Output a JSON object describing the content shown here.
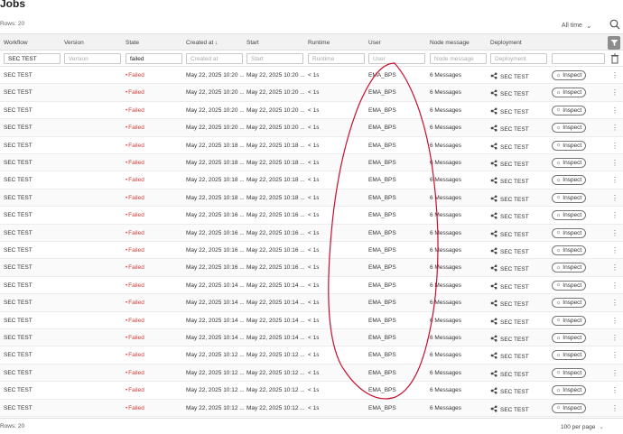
{
  "header": {
    "title": "Jobs",
    "rows_label": "Rows: 20",
    "time_filter": "All time"
  },
  "columns": [
    "Workflow",
    "Version",
    "State",
    "Created at",
    "Start",
    "Runtime",
    "User",
    "Node message",
    "Deployment"
  ],
  "filters": {
    "workflow": {
      "value": "SEC TEST",
      "placeholder": ""
    },
    "version": {
      "value": "",
      "placeholder": "Version"
    },
    "state": {
      "value": "failed",
      "placeholder": ""
    },
    "created": {
      "value": "",
      "placeholder": "Created at"
    },
    "start": {
      "value": "",
      "placeholder": "Start"
    },
    "runtime": {
      "value": "",
      "placeholder": "Runtime"
    },
    "user": {
      "value": "",
      "placeholder": "User"
    },
    "node": {
      "value": "",
      "placeholder": "Node message"
    },
    "deployment": {
      "value": "",
      "placeholder": "Deployment"
    },
    "extra": {
      "value": "",
      "placeholder": ""
    }
  },
  "rows": [
    {
      "workflow": "SEC TEST",
      "state": "Failed",
      "created": "May 22, 2025 10:20 ...",
      "start": "May 22, 2025 10:20 ...",
      "runtime": "< 1s",
      "user": "EMA_BPS",
      "node": "6 Messages",
      "deployment": "SEC TEST"
    },
    {
      "workflow": "SEC TEST",
      "state": "Failed",
      "created": "May 22, 2025 10:20 ...",
      "start": "May 22, 2025 10:20 ...",
      "runtime": "< 1s",
      "user": "EMA_BPS",
      "node": "6 Messages",
      "deployment": "SEC TEST"
    },
    {
      "workflow": "SEC TEST",
      "state": "Failed",
      "created": "May 22, 2025 10:20 ...",
      "start": "May 22, 2025 10:20 ...",
      "runtime": "< 1s",
      "user": "EMA_BPS",
      "node": "6 Messages",
      "deployment": "SEC TEST"
    },
    {
      "workflow": "SEC TEST",
      "state": "Failed",
      "created": "May 22, 2025 10:20 ...",
      "start": "May 22, 2025 10:20 ...",
      "runtime": "< 1s",
      "user": "EMA_BPS",
      "node": "6 Messages",
      "deployment": "SEC TEST"
    },
    {
      "workflow": "SEC TEST",
      "state": "Failed",
      "created": "May 22, 2025 10:18 ...",
      "start": "May 22, 2025 10:18 ...",
      "runtime": "< 1s",
      "user": "EMA_BPS",
      "node": "6 Messages",
      "deployment": "SEC TEST"
    },
    {
      "workflow": "SEC TEST",
      "state": "Failed",
      "created": "May 22, 2025 10:18 ...",
      "start": "May 22, 2025 10:18 ...",
      "runtime": "< 1s",
      "user": "EMA_BPS",
      "node": "6 Messages",
      "deployment": "SEC TEST"
    },
    {
      "workflow": "SEC TEST",
      "state": "Failed",
      "created": "May 22, 2025 10:18 ...",
      "start": "May 22, 2025 10:18 ...",
      "runtime": "< 1s",
      "user": "EMA_BPS",
      "node": "6 Messages",
      "deployment": "SEC TEST"
    },
    {
      "workflow": "SEC TEST",
      "state": "Failed",
      "created": "May 22, 2025 10:18 ...",
      "start": "May 22, 2025 10:18 ...",
      "runtime": "< 1s",
      "user": "EMA_BPS",
      "node": "6 Messages",
      "deployment": "SEC TEST"
    },
    {
      "workflow": "SEC TEST",
      "state": "Failed",
      "created": "May 22, 2025 10:16 ...",
      "start": "May 22, 2025 10:16 ...",
      "runtime": "< 1s",
      "user": "EMA_BPS",
      "node": "6 Messages",
      "deployment": "SEC TEST"
    },
    {
      "workflow": "SEC TEST",
      "state": "Failed",
      "created": "May 22, 2025 10:16 ...",
      "start": "May 22, 2025 10:16 ...",
      "runtime": "< 1s",
      "user": "EMA_BPS",
      "node": "6 Messages",
      "deployment": "SEC TEST"
    },
    {
      "workflow": "SEC TEST",
      "state": "Failed",
      "created": "May 22, 2025 10:16 ...",
      "start": "May 22, 2025 10:16 ...",
      "runtime": "< 1s",
      "user": "EMA_BPS",
      "node": "6 Messages",
      "deployment": "SEC TEST"
    },
    {
      "workflow": "SEC TEST",
      "state": "Failed",
      "created": "May 22, 2025 10:16 ...",
      "start": "May 22, 2025 10:16 ...",
      "runtime": "< 1s",
      "user": "EMA_BPS",
      "node": "6 Messages",
      "deployment": "SEC TEST"
    },
    {
      "workflow": "SEC TEST",
      "state": "Failed",
      "created": "May 22, 2025 10:14 ...",
      "start": "May 22, 2025 10:14 ...",
      "runtime": "< 1s",
      "user": "EMA_BPS",
      "node": "6 Messages",
      "deployment": "SEC TEST"
    },
    {
      "workflow": "SEC TEST",
      "state": "Failed",
      "created": "May 22, 2025 10:14 ...",
      "start": "May 22, 2025 10:14 ...",
      "runtime": "< 1s",
      "user": "EMA_BPS",
      "node": "6 Messages",
      "deployment": "SEC TEST"
    },
    {
      "workflow": "SEC TEST",
      "state": "Failed",
      "created": "May 22, 2025 10:14 ...",
      "start": "May 22, 2025 10:14 ...",
      "runtime": "< 1s",
      "user": "EMA_BPS",
      "node": "6 Messages",
      "deployment": "SEC TEST"
    },
    {
      "workflow": "SEC TEST",
      "state": "Failed",
      "created": "May 22, 2025 10:14 ...",
      "start": "May 22, 2025 10:14 ...",
      "runtime": "< 1s",
      "user": "EMA_BPS",
      "node": "6 Messages",
      "deployment": "SEC TEST"
    },
    {
      "workflow": "SEC TEST",
      "state": "Failed",
      "created": "May 22, 2025 10:12 ...",
      "start": "May 22, 2025 10:12 ...",
      "runtime": "< 1s",
      "user": "EMA_BPS",
      "node": "6 Messages",
      "deployment": "SEC TEST"
    },
    {
      "workflow": "SEC TEST",
      "state": "Failed",
      "created": "May 22, 2025 10:12 ...",
      "start": "May 22, 2025 10:12 ...",
      "runtime": "< 1s",
      "user": "EMA_BPS",
      "node": "6 Messages",
      "deployment": "SEC TEST"
    },
    {
      "workflow": "SEC TEST",
      "state": "Failed",
      "created": "May 22, 2025 10:12 ...",
      "start": "May 22, 2025 10:12 ...",
      "runtime": "< 1s",
      "user": "EMA_BPS",
      "node": "6 Messages",
      "deployment": "SEC TEST"
    },
    {
      "workflow": "SEC TEST",
      "state": "Failed",
      "created": "May 22, 2025 10:12 ...",
      "start": "May 22, 2025 10:12 ...",
      "runtime": "< 1s",
      "user": "EMA_BPS",
      "node": "6 Messages",
      "deployment": "SEC TEST"
    }
  ],
  "row_actions": {
    "inspect_label": "Inspect"
  },
  "footer": {
    "rows_label": "Rows: 20",
    "per_page": "100 per page"
  },
  "icons": {
    "search": "search-icon",
    "filter": "filter-icon",
    "trash": "trash-icon",
    "deployment": "deployment-icon",
    "inspect": "eye-icon",
    "kebab": "more-vertical-icon"
  },
  "colors": {
    "failed": "#d23c3c",
    "annotation": "#c8102e"
  }
}
